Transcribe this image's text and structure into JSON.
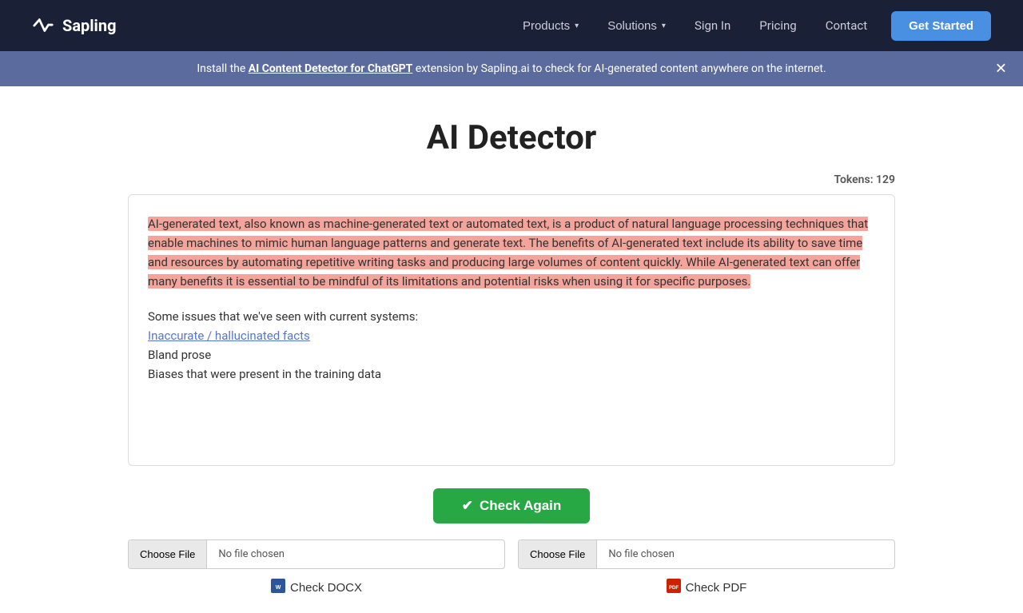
{
  "navbar": {
    "brand": "Sapling",
    "links": [
      {
        "label": "Products",
        "id": "products",
        "dropdown": true
      },
      {
        "label": "Solutions",
        "id": "solutions",
        "dropdown": true
      },
      {
        "label": "Sign In",
        "id": "signin",
        "dropdown": false
      },
      {
        "label": "Pricing",
        "id": "pricing",
        "dropdown": false
      },
      {
        "label": "Contact",
        "id": "contact",
        "dropdown": false
      }
    ],
    "cta": "Get Started"
  },
  "banner": {
    "text_before": "Install the ",
    "link_text": "AI Content Detector for ChatGPT",
    "text_after": " extension by Sapling.ai to check for AI-generated content anywhere on the internet."
  },
  "page": {
    "title": "AI Detector",
    "tokens_label": "Tokens: 129"
  },
  "text_content": {
    "highlighted": "AI-generated text, also known as machine-generated text or automated text, is a product of natural language processing techniques that enable machines to mimic human language patterns and generate text. The benefits of AI-generated text include its ability to save time and resources by automating repetitive writing tasks and producing large volumes of content quickly. While AI-generated text can offer many benefits it is essential to be mindful of its limitations and potential risks when using it for specific purposes.",
    "normal_intro": "Some issues that we've seen with current systems:",
    "list_items": [
      "Inaccurate / hallucinated facts",
      "Bland prose",
      "Biases that were present in the training data"
    ]
  },
  "check_again_button": "Check Again",
  "file_upload_left": {
    "choose_label": "Choose File",
    "no_file_text": "No file chosen"
  },
  "file_upload_right": {
    "choose_label": "Choose File",
    "no_file_text": "No file chosen"
  },
  "check_docx_button": "Check DOCX",
  "check_pdf_button": "Check PDF"
}
